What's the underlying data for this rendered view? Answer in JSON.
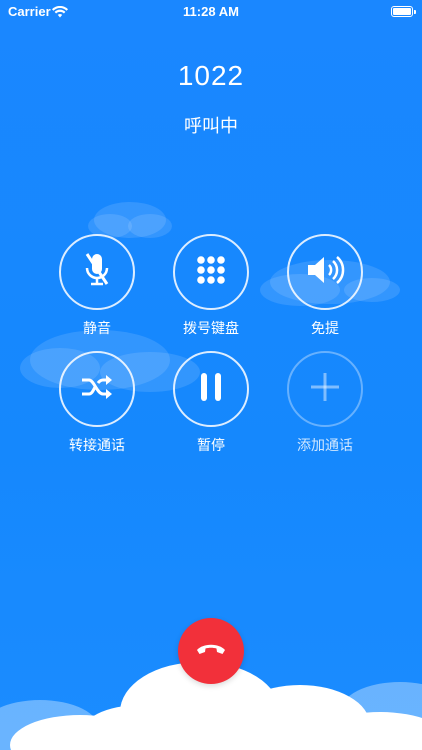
{
  "status_bar": {
    "carrier": "Carrier",
    "time": "11:28 AM"
  },
  "call": {
    "number": "1022",
    "status": "呼叫中"
  },
  "controls": [
    {
      "label": "静音",
      "icon": "mic-muted-icon"
    },
    {
      "label": "拨号键盘",
      "icon": "keypad-icon"
    },
    {
      "label": "免提",
      "icon": "speaker-icon"
    },
    {
      "label": "转接通话",
      "icon": "shuffle-transfer-icon"
    },
    {
      "label": "暂停",
      "icon": "pause-icon"
    },
    {
      "label": "添加通话",
      "icon": "plus-icon"
    }
  ],
  "colors": {
    "background": "#1588fd",
    "hangup": "#f2303a",
    "text": "#ffffff"
  }
}
